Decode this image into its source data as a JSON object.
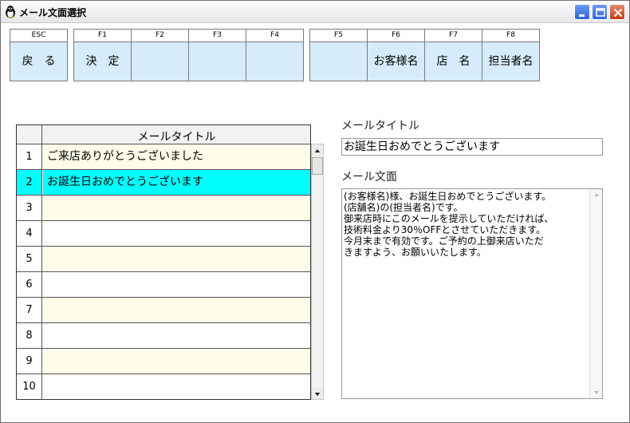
{
  "window": {
    "title": "メール文面選択"
  },
  "function_keys": [
    {
      "key": "ESC",
      "caption": "戻る"
    },
    {
      "key": "F1",
      "caption": "決定"
    },
    {
      "key": "F2",
      "caption": ""
    },
    {
      "key": "F3",
      "caption": ""
    },
    {
      "key": "F4",
      "caption": ""
    },
    {
      "key": "F5",
      "caption": ""
    },
    {
      "key": "F6",
      "caption": "お客様名"
    },
    {
      "key": "F7",
      "caption": "店名"
    },
    {
      "key": "F8",
      "caption": "担当者名"
    }
  ],
  "grid": {
    "header": "メールタイトル",
    "rows": [
      {
        "num": "1",
        "title": "ご来店ありがとうございました"
      },
      {
        "num": "2",
        "title": "お誕生日おめでとうございます"
      },
      {
        "num": "3",
        "title": ""
      },
      {
        "num": "4",
        "title": ""
      },
      {
        "num": "5",
        "title": ""
      },
      {
        "num": "6",
        "title": ""
      },
      {
        "num": "7",
        "title": ""
      },
      {
        "num": "8",
        "title": ""
      },
      {
        "num": "9",
        "title": ""
      },
      {
        "num": "10",
        "title": ""
      }
    ],
    "selected_row": "2"
  },
  "detail": {
    "title_label": "メールタイトル",
    "title_value": "お誕生日おめでとうございます",
    "body_label": "メール文面",
    "body_value": "(お客様名)様、お誕生日おめでとうございます。\n(店舗名)の(担当者名)です。\n御来店時にこのメールを提示していただければ、\n技術料金より30％OFFとさせていただきます。\n今月末まで有効です。ご予約の上御来店いただ\nきますよう、お願いいたします。"
  },
  "colors": {
    "fkey_face": "#d6ecfa",
    "selected_row": "#00ffff",
    "odd_row": "#fdfdea"
  }
}
